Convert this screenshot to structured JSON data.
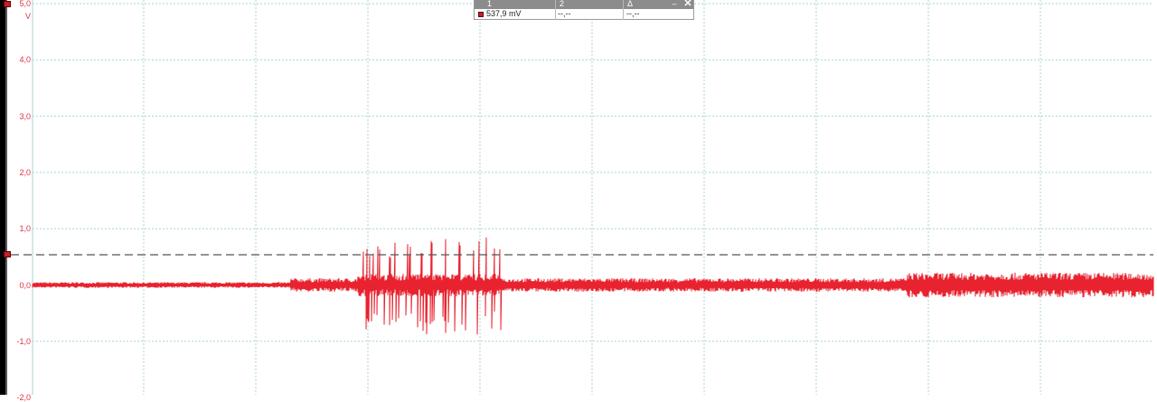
{
  "chart_data": {
    "type": "line",
    "title": "",
    "xlabel": "",
    "ylabel": "V",
    "ylim": [
      -2.0,
      5.0
    ],
    "y_ticks": [
      "5,0",
      "4,0",
      "3,0",
      "2,0",
      "1,0",
      "0,0",
      "-1,0",
      "-2,0"
    ],
    "grid": true,
    "grid_color": "#a9d3d6",
    "series": [
      {
        "color": "#e8232f",
        "baseline": 0.0,
        "segments": [
          {
            "x_start": 0.0,
            "x_end": 0.23,
            "amplitude": 0.05
          },
          {
            "x_start": 0.23,
            "x_end": 0.29,
            "amplitude": 0.12
          },
          {
            "x_start": 0.29,
            "x_end": 0.42,
            "amplitude": 0.2,
            "spikes_up": 0.85,
            "spikes_down": -0.85
          },
          {
            "x_start": 0.42,
            "x_end": 0.78,
            "amplitude": 0.12
          },
          {
            "x_start": 0.78,
            "x_end": 1.0,
            "amplitude": 0.22
          }
        ]
      }
    ],
    "ruler_level": 0.5379
  },
  "ruler": {
    "col1": "1",
    "col2": "2",
    "col3": "Δ",
    "val1": "537,9 mV",
    "val2": "--,--",
    "val3": "--,--",
    "minimize": "–",
    "close": "✕"
  },
  "colors": {
    "axis_text": "#e03040",
    "trace": "#e8232f",
    "ruler_line": "#555555",
    "grid": "#a9d3d6"
  }
}
